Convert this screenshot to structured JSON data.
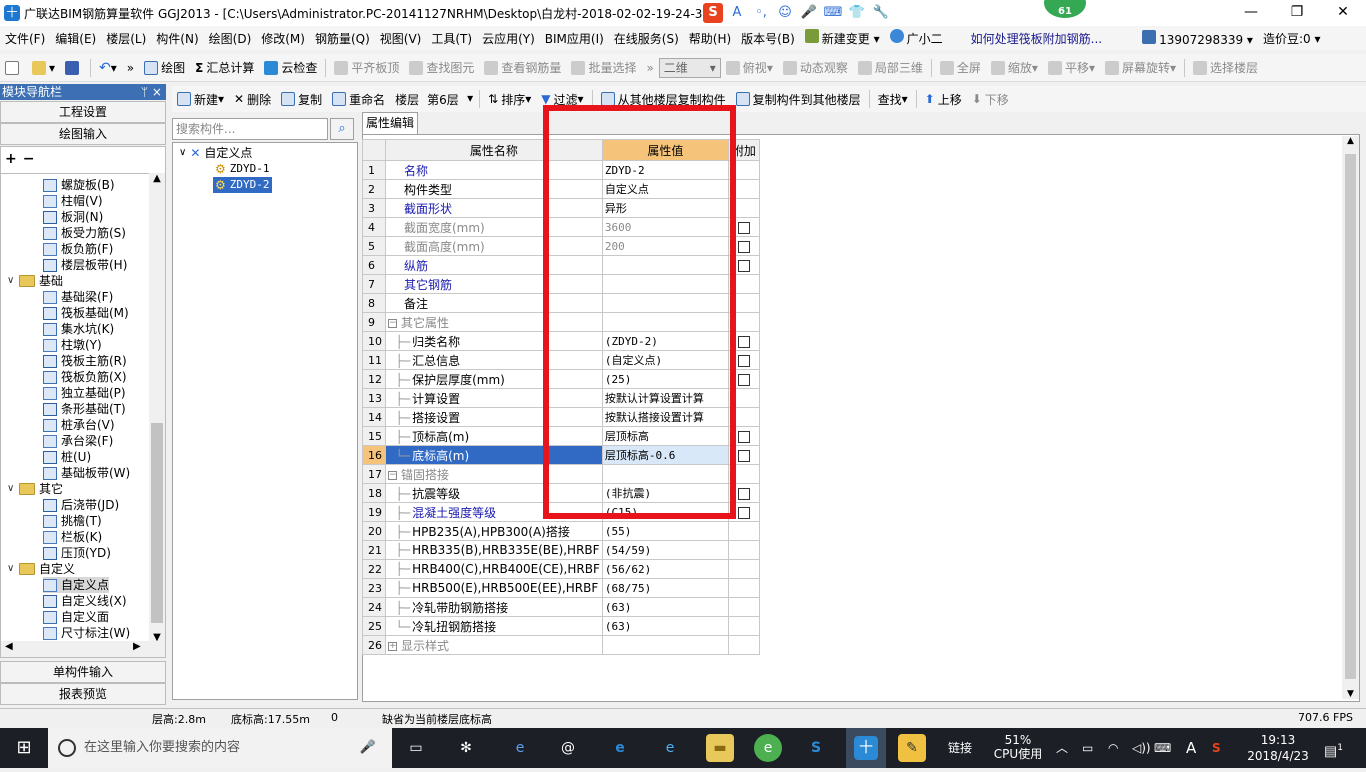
{
  "window": {
    "title": "广联达BIM钢筋算量软件 GGJ2013 - [C:\\Users\\Administrator.PC-20141127NRHM\\Desktop\\白龙村-2018-02-02-19-24-35",
    "badge": "61",
    "min": "—",
    "restore": "❐",
    "close": "✕"
  },
  "menu": {
    "items": [
      "文件(F)",
      "编辑(E)",
      "楼层(L)",
      "构件(N)",
      "绘图(D)",
      "修改(M)",
      "钢筋量(Q)",
      "视图(V)",
      "工具(T)",
      "云应用(Y)",
      "BIM应用(I)",
      "在线服务(S)",
      "帮助(H)",
      "版本号(B)",
      "新建变更",
      "广小二"
    ],
    "help_link": "如何处理筏板附加钢筋...",
    "phone": "13907298339",
    "beans": "造价豆:0"
  },
  "toolbar1": {
    "draw": "绘图",
    "sum": "汇总计算",
    "cloud_check": "云检查",
    "flat_top": "平齐板顶",
    "find_elem": "查找图元",
    "view_rebar": "查看钢筋量",
    "batch_select": "批量选择",
    "view_mode": "二维",
    "top_view": "俯视",
    "dynamic": "动态观察",
    "local_3d": "局部三维",
    "fullscreen": "全屏",
    "zoom": "缩放",
    "pan": "平移",
    "rotate": "屏幕旋转",
    "select_floor": "选择楼层"
  },
  "toolbar2": {
    "new": "新建",
    "delete": "删除",
    "copy": "复制",
    "rename": "重命名",
    "floor_label": "楼层",
    "floor_value": "第6层",
    "sort": "排序",
    "filter": "过滤",
    "copy_from": "从其他楼层复制构件",
    "copy_to": "复制构件到其他楼层",
    "find": "查找",
    "move_up": "上移",
    "move_down": "下移"
  },
  "nav": {
    "header": "模块导航栏",
    "pin": "ᛘ ×",
    "project_settings": "工程设置",
    "drawing_input": "绘图输入",
    "single_input": "单构件输入",
    "report_preview": "报表预览",
    "tree": [
      {
        "label": "螺旋板(B)",
        "level": 2
      },
      {
        "label": "柱帽(V)",
        "level": 2
      },
      {
        "label": "板洞(N)",
        "level": 2
      },
      {
        "label": "板受力筋(S)",
        "level": 2
      },
      {
        "label": "板负筋(F)",
        "level": 2
      },
      {
        "label": "楼层板带(H)",
        "level": 2
      },
      {
        "label": "基础",
        "level": 1
      },
      {
        "label": "基础梁(F)",
        "level": 2
      },
      {
        "label": "筏板基础(M)",
        "level": 2
      },
      {
        "label": "集水坑(K)",
        "level": 2
      },
      {
        "label": "柱墩(Y)",
        "level": 2
      },
      {
        "label": "筏板主筋(R)",
        "level": 2
      },
      {
        "label": "筏板负筋(X)",
        "level": 2
      },
      {
        "label": "独立基础(P)",
        "level": 2
      },
      {
        "label": "条形基础(T)",
        "level": 2
      },
      {
        "label": "桩承台(V)",
        "level": 2
      },
      {
        "label": "承台梁(F)",
        "level": 2
      },
      {
        "label": "桩(U)",
        "level": 2
      },
      {
        "label": "基础板带(W)",
        "level": 2
      },
      {
        "label": "其它",
        "level": 1
      },
      {
        "label": "后浇带(JD)",
        "level": 2
      },
      {
        "label": "挑檐(T)",
        "level": 2
      },
      {
        "label": "栏板(K)",
        "level": 2
      },
      {
        "label": "压顶(YD)",
        "level": 2
      },
      {
        "label": "自定义",
        "level": 1
      },
      {
        "label": "自定义点",
        "level": 2
      },
      {
        "label": "自定义线(X)",
        "level": 2
      },
      {
        "label": "自定义面",
        "level": 2
      },
      {
        "label": "尺寸标注(W)",
        "level": 2
      }
    ]
  },
  "components": {
    "search_placeholder": "搜索构件...",
    "root": "自定义点",
    "items": [
      "ZDYD-1",
      "ZDYD-2"
    ]
  },
  "props": {
    "tab": "属性编辑",
    "headers": {
      "name": "属性名称",
      "value": "属性值",
      "extra": "附加"
    },
    "rows": [
      {
        "n": "1",
        "name": "名称",
        "value": "ZDYD-2",
        "style": "link",
        "cb": false
      },
      {
        "n": "2",
        "name": "构件类型",
        "value": "自定义点",
        "style": "",
        "cb": false
      },
      {
        "n": "3",
        "name": "截面形状",
        "value": "异形",
        "style": "link",
        "cb": false
      },
      {
        "n": "4",
        "name": "截面宽度(mm)",
        "value": "3600",
        "style": "grey",
        "cb": true
      },
      {
        "n": "5",
        "name": "截面高度(mm)",
        "value": "200",
        "style": "grey",
        "cb": true
      },
      {
        "n": "6",
        "name": "纵筋",
        "value": "",
        "style": "link",
        "cb": true
      },
      {
        "n": "7",
        "name": "其它钢筋",
        "value": "",
        "style": "link",
        "cb": false
      },
      {
        "n": "8",
        "name": "备注",
        "value": "",
        "style": "",
        "cb": false
      },
      {
        "n": "9",
        "name": "其它属性",
        "value": "",
        "style": "group",
        "cb": false
      },
      {
        "n": "10",
        "name": "归类名称",
        "value": "(ZDYD-2)",
        "style": "child",
        "cb": true
      },
      {
        "n": "11",
        "name": "汇总信息",
        "value": "(自定义点)",
        "style": "child",
        "cb": true
      },
      {
        "n": "12",
        "name": "保护层厚度(mm)",
        "value": "(25)",
        "style": "child",
        "cb": true
      },
      {
        "n": "13",
        "name": "计算设置",
        "value": "按默认计算设置计算",
        "style": "child",
        "cb": false
      },
      {
        "n": "14",
        "name": "搭接设置",
        "value": "按默认搭接设置计算",
        "style": "child",
        "cb": false
      },
      {
        "n": "15",
        "name": "顶标高(m)",
        "value": "层顶标高",
        "style": "child",
        "cb": true
      },
      {
        "n": "16",
        "name": "底标高(m)",
        "value": "层顶标高-0.6",
        "style": "child-last selected",
        "cb": true
      },
      {
        "n": "17",
        "name": "锚固搭接",
        "value": "",
        "style": "group",
        "cb": false
      },
      {
        "n": "18",
        "name": "抗震等级",
        "value": "(非抗震)",
        "style": "child",
        "cb": true
      },
      {
        "n": "19",
        "name": "混凝土强度等级",
        "value": "(C15)",
        "style": "child link",
        "cb": true
      },
      {
        "n": "20",
        "name": "HPB235(A),HPB300(A)搭接",
        "value": "(55)",
        "style": "child",
        "cb": false
      },
      {
        "n": "21",
        "name": "HRB335(B),HRB335E(BE),HRBF",
        "value": "(54/59)",
        "style": "child",
        "cb": false
      },
      {
        "n": "22",
        "name": "HRB400(C),HRB400E(CE),HRBF",
        "value": "(56/62)",
        "style": "child",
        "cb": false
      },
      {
        "n": "23",
        "name": "HRB500(E),HRB500E(EE),HRBF",
        "value": "(68/75)",
        "style": "child",
        "cb": false
      },
      {
        "n": "24",
        "name": "冷轧带肋钢筋搭接",
        "value": "(63)",
        "style": "child",
        "cb": false
      },
      {
        "n": "25",
        "name": "冷轧扭钢筋搭接",
        "value": "(63)",
        "style": "child-last",
        "cb": false
      },
      {
        "n": "26",
        "name": "显示样式",
        "value": "",
        "style": "group-collapsed",
        "cb": false
      }
    ]
  },
  "status": {
    "floor_height": "层高:2.8m",
    "bottom_elev": "底标高:17.55m",
    "zero": "0",
    "hint": "缺省为当前楼层底标高",
    "fps": "707.6 FPS"
  },
  "taskbar": {
    "search_placeholder": "在这里输入你要搜索的内容",
    "link": "链接",
    "cpu_pct": "51%",
    "cpu_label": "CPU使用",
    "ime": "A",
    "time": "19:13",
    "date": "2018/4/23",
    "notif": "1"
  }
}
